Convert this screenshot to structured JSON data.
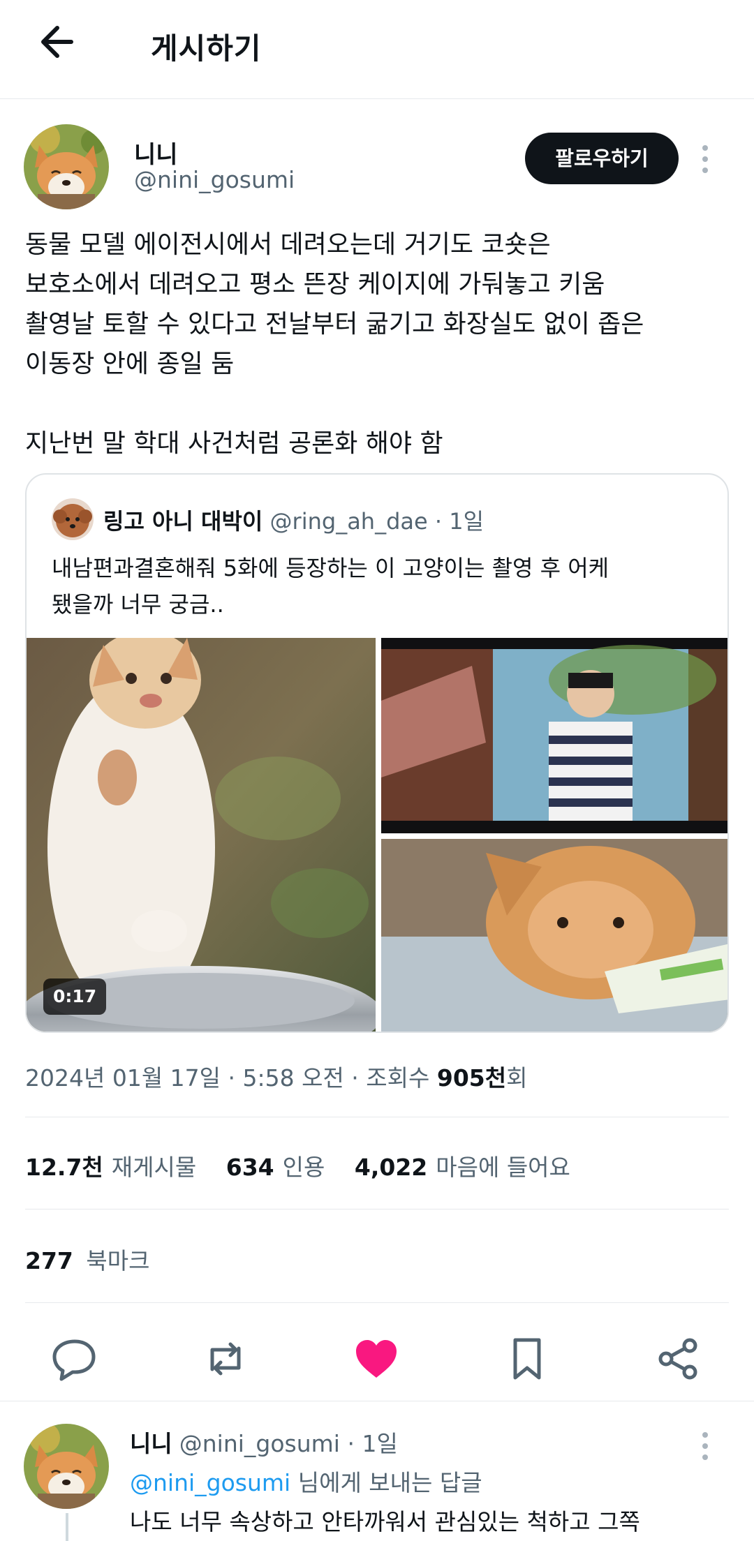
{
  "header": {
    "title": "게시하기"
  },
  "author": {
    "name": "니니",
    "handle": "@nini_gosumi",
    "follow_label": "팔로우하기"
  },
  "tweet": {
    "lines": [
      "동물 모델 에이전시에서 데려오는데 거기도 코숏은",
      "보호소에서 데려오고 평소 뜬장 케이지에 가둬놓고 키움",
      "촬영날 토할 수 있다고 전날부터 굶기고 화장실도 없이 좁은",
      "이동장 안에 종일 둠",
      "지난번 말 학대 사건처럼 공론화 해야 함"
    ]
  },
  "quote": {
    "name": "링고 아니 대박이",
    "handle": "@ring_ah_dae",
    "time": "· 1일",
    "text_lines": [
      "내남편과결혼해줘 5화에 등장하는 이 고양이는 촬영 후 어케",
      "됐을까 너무 궁금.."
    ],
    "video_duration": "0:17"
  },
  "meta": {
    "date": "2024년 01월 17일 · 5:58 오전 · 조회수 ",
    "views": "905천",
    "views_suffix": "회"
  },
  "stats": {
    "retweets": {
      "value": "12.7천",
      "label": "재게시물"
    },
    "quotes": {
      "value": "634",
      "label": "인용"
    },
    "likes": {
      "value": "4,022",
      "label": "마음에 들어요"
    },
    "bookmarks": {
      "value": "277",
      "label": "북마크"
    }
  },
  "actions": [
    {
      "icon": "reply-icon"
    },
    {
      "icon": "retweet-icon"
    },
    {
      "icon": "heart-icon",
      "active": true
    },
    {
      "icon": "bookmark-icon"
    },
    {
      "icon": "share-icon"
    }
  ],
  "reply": {
    "name": "니니",
    "handle": "@nini_gosumi",
    "time": "· 1일",
    "reply_to_mention": "@nini_gosumi",
    "reply_to_suffix": " 님에게 보내는 답글",
    "text": "나도 너무 속상하고 안타까워서 관심있는 척하고 그쪽"
  },
  "colors": {
    "accent": "#1d9bf0",
    "like": "#f91880",
    "text": "#0f1419",
    "muted": "#536471"
  }
}
